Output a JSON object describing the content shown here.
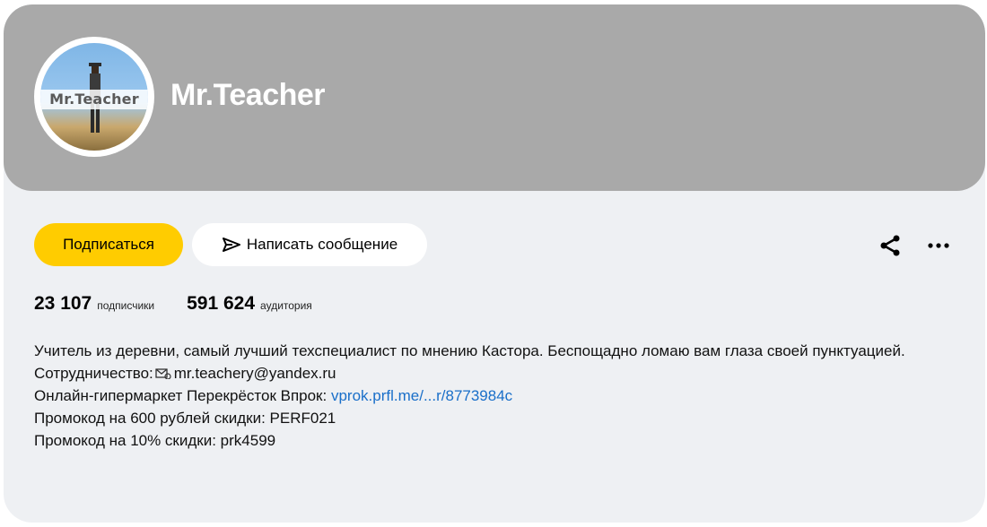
{
  "channel": {
    "name": "Mr.Teacher",
    "avatar_label": "Mr.Teacher"
  },
  "actions": {
    "subscribe_label": "Подписаться",
    "message_label": "Написать сообщение",
    "share_icon": "share-icon",
    "more_icon": "more-icon"
  },
  "stats": {
    "subscribers_value": "23 107",
    "subscribers_label": "подписчики",
    "audience_value": "591 624",
    "audience_label": "аудитория"
  },
  "description": {
    "line1": "Учитель из деревни, самый лучший техспециалист по мнению Кастора. Беспощадно ломаю вам глаза своей пунктуацией.",
    "coop_label": "Сотрудничество:",
    "coop_email": "mr.teachery@yandex.ru",
    "store_label": "Онлайн-гипермаркет Перекрёсток Впрок:",
    "store_link": "vprok.prfl.me/...r/8773984c",
    "promo1": "Промокод на 600 рублей скидки: PERF021",
    "promo2": "Промокод на 10% скидки: prk4599"
  },
  "colors": {
    "cover": "#a9a9a9",
    "card_bg": "#eef0f3",
    "subscribe": "#ffcc00",
    "link": "#1a6fc9"
  }
}
